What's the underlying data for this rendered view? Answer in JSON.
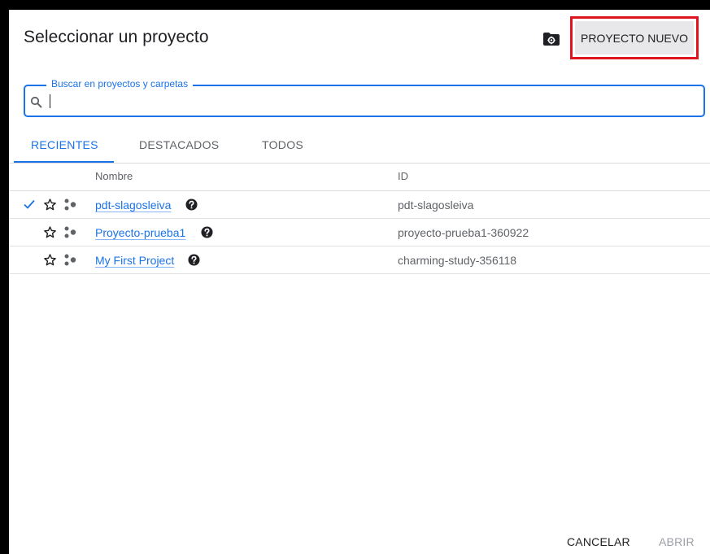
{
  "dialog": {
    "title": "Seleccionar un proyecto",
    "new_project_label": "PROYECTO NUEVO"
  },
  "search": {
    "label": "Buscar en proyectos y carpetas",
    "value": ""
  },
  "tabs": [
    {
      "label": "RECIENTES",
      "active": true
    },
    {
      "label": "DESTACADOS",
      "active": false
    },
    {
      "label": "TODOS",
      "active": false
    }
  ],
  "table": {
    "columns": {
      "name": "Nombre",
      "id": "ID"
    },
    "rows": [
      {
        "name": "pdt-slagosleiva",
        "id": "pdt-slagosleiva",
        "selected": true,
        "starred": false
      },
      {
        "name": "Proyecto-prueba1",
        "id": "proyecto-prueba1-360922",
        "selected": false,
        "starred": false
      },
      {
        "name": "My First Project",
        "id": "charming-study-356118",
        "selected": false,
        "starred": false
      }
    ]
  },
  "footer": {
    "cancel_label": "CANCELAR",
    "open_label": "ABRIR"
  },
  "icons": {
    "header": "folder-settings-icon",
    "search": "search-icon",
    "row": [
      "check-icon",
      "star-outline-icon",
      "project-icon",
      "help-icon"
    ]
  },
  "colors": {
    "accent": "#1a73e8",
    "highlight_outline": "#e0141e"
  }
}
